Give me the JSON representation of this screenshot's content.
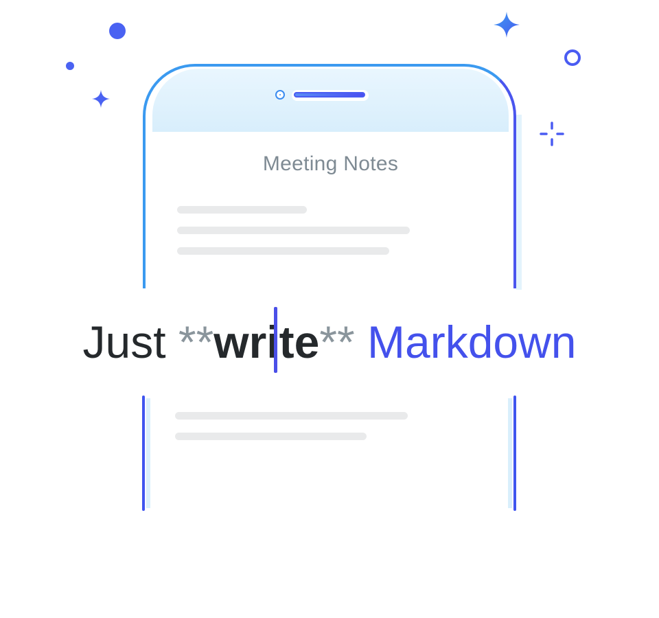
{
  "note": {
    "title": "Meeting Notes"
  },
  "headline": {
    "word1": "Just",
    "stars_open": "**",
    "bold_word": "write",
    "stars_close": "**",
    "word_last": "Markdown"
  },
  "colors": {
    "accent": "#4451ec",
    "phone_edge": "#3b9af0",
    "text_dark": "#25292c",
    "text_muted": "#8a959c",
    "placeholder_line": "#e9eaeb"
  },
  "icons": {
    "sparkles": [
      "sparkle-icon",
      "sparkle-icon",
      "sparkle-outline-icon"
    ],
    "dots": [
      "dot-icon",
      "dot-icon"
    ],
    "rings": [
      "ring-icon"
    ]
  }
}
